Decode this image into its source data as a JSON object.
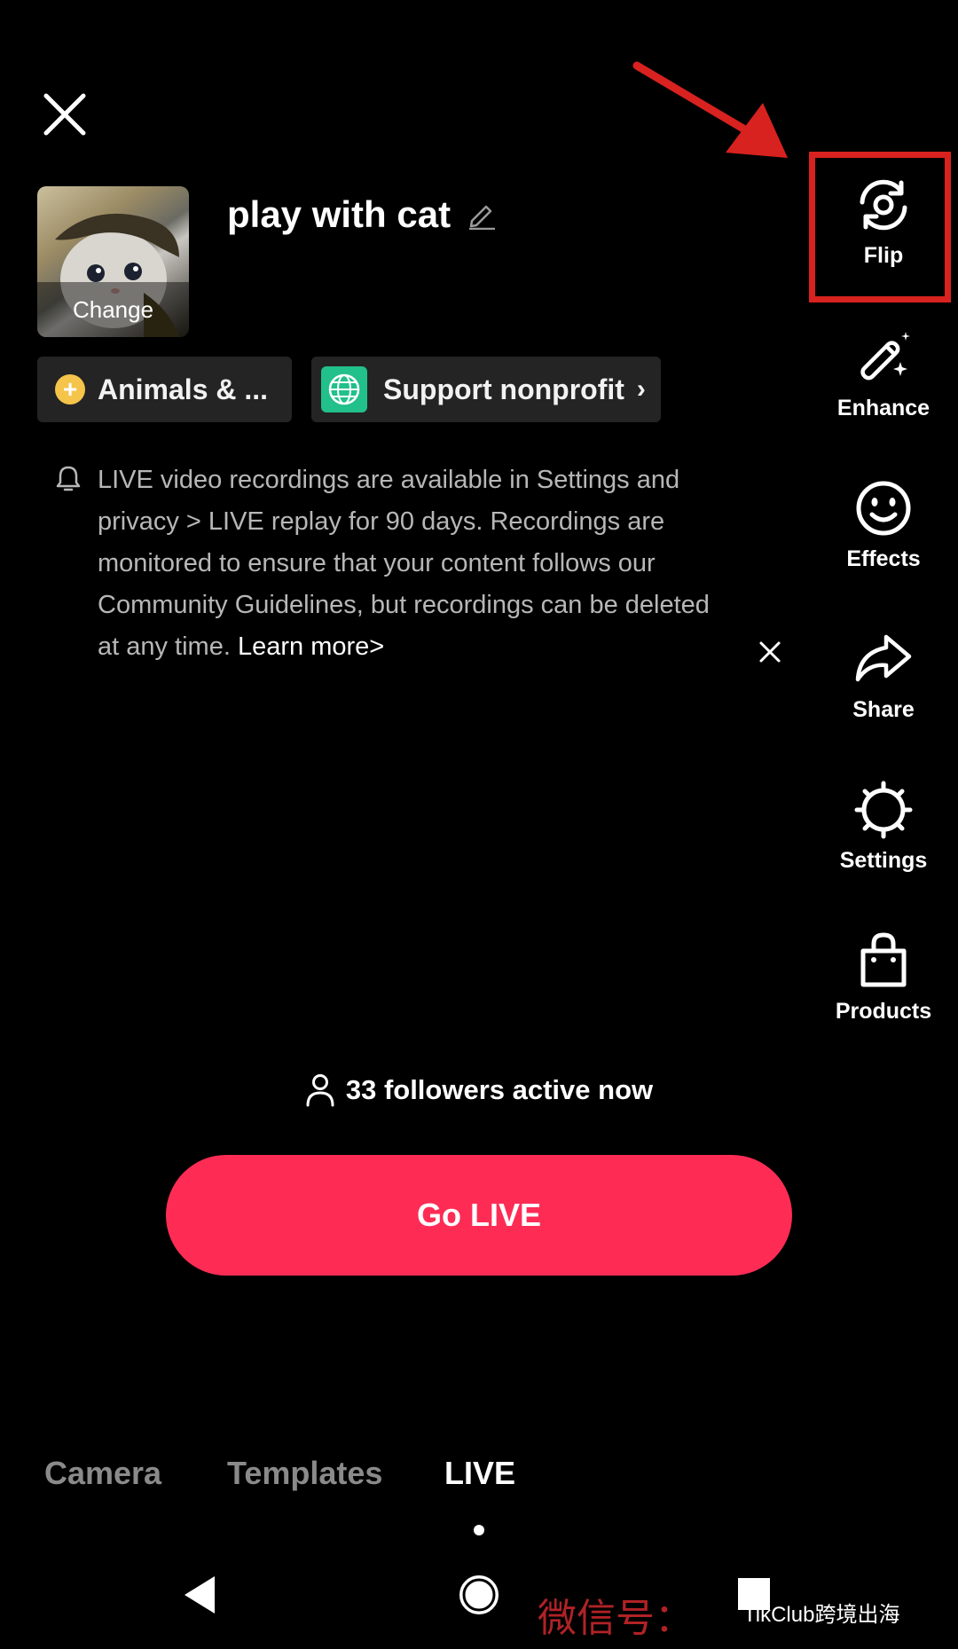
{
  "live_setup": {
    "title": "play with cat",
    "cover_label": "Change",
    "category_label": "Animals & ...",
    "nonprofit_label": "Support nonprofit",
    "notice_text": "LIVE video recordings are available in Settings and privacy > LIVE replay for 90 days. Recordings are monitored to ensure that your content follows our Community Guidelines, but recordings can be deleted at any time.",
    "notice_link": "Learn more>",
    "followers_text": "33 followers active now",
    "go_live_label": "Go LIVE"
  },
  "tools": {
    "flip": "Flip",
    "enhance": "Enhance",
    "effects": "Effects",
    "share": "Share",
    "settings": "Settings",
    "products": "Products"
  },
  "mode_tabs": {
    "camera": "Camera",
    "templates": "Templates",
    "live": "LIVE"
  },
  "watermark": {
    "text": "微信号：",
    "brand": "TikClub跨境出海"
  },
  "colors": {
    "accent": "#fe2c55",
    "annotation": "#d8221f"
  }
}
